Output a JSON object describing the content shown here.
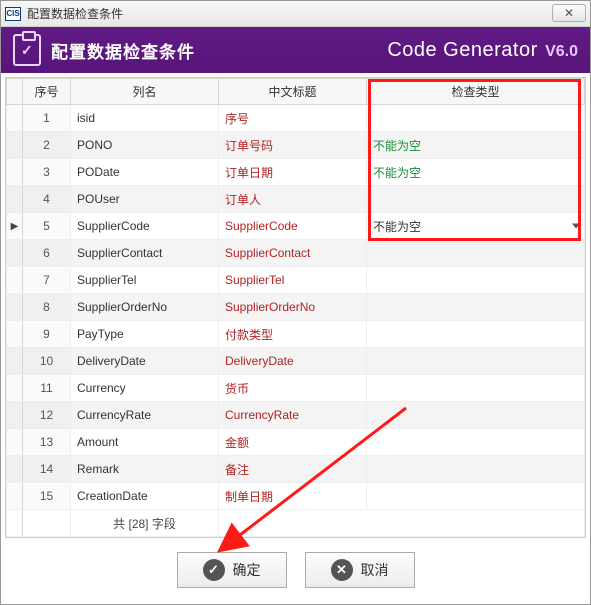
{
  "window": {
    "app_icon_text": "CIS",
    "title": "配置数据检查条件"
  },
  "banner": {
    "title": "配置数据检查条件",
    "brand": "Code Generator",
    "version": "V6.0"
  },
  "grid": {
    "headers": {
      "index": "序号",
      "col_name": "列名",
      "cn_title": "中文标题",
      "check_type": "检查类型"
    },
    "rows": [
      {
        "idx": "1",
        "name": "isid",
        "cn": "序号",
        "check": "",
        "marker": false,
        "dropdown": false
      },
      {
        "idx": "2",
        "name": "PONO",
        "cn": "订单号码",
        "check": "不能为空",
        "marker": false,
        "dropdown": false
      },
      {
        "idx": "3",
        "name": "PODate",
        "cn": "订单日期",
        "check": "不能为空",
        "marker": false,
        "dropdown": false
      },
      {
        "idx": "4",
        "name": "POUser",
        "cn": "订单人",
        "check": "",
        "marker": false,
        "dropdown": false
      },
      {
        "idx": "5",
        "name": "SupplierCode",
        "cn": "SupplierCode",
        "check": "不能为空",
        "marker": true,
        "dropdown": true
      },
      {
        "idx": "6",
        "name": "SupplierContact",
        "cn": "SupplierContact",
        "check": "",
        "marker": false,
        "dropdown": false
      },
      {
        "idx": "7",
        "name": "SupplierTel",
        "cn": "SupplierTel",
        "check": "",
        "marker": false,
        "dropdown": false
      },
      {
        "idx": "8",
        "name": "SupplierOrderNo",
        "cn": "SupplierOrderNo",
        "check": "",
        "marker": false,
        "dropdown": false
      },
      {
        "idx": "9",
        "name": "PayType",
        "cn": "付款类型",
        "check": "",
        "marker": false,
        "dropdown": false
      },
      {
        "idx": "10",
        "name": "DeliveryDate",
        "cn": "DeliveryDate",
        "check": "",
        "marker": false,
        "dropdown": false
      },
      {
        "idx": "11",
        "name": "Currency",
        "cn": "货币",
        "check": "",
        "marker": false,
        "dropdown": false
      },
      {
        "idx": "12",
        "name": "CurrencyRate",
        "cn": "CurrencyRate",
        "check": "",
        "marker": false,
        "dropdown": false
      },
      {
        "idx": "13",
        "name": "Amount",
        "cn": "金额",
        "check": "",
        "marker": false,
        "dropdown": false
      },
      {
        "idx": "14",
        "name": "Remark",
        "cn": "备注",
        "check": "",
        "marker": false,
        "dropdown": false
      },
      {
        "idx": "15",
        "name": "CreationDate",
        "cn": "制单日期",
        "check": "",
        "marker": false,
        "dropdown": false
      }
    ],
    "footer": "共 [28] 字段"
  },
  "buttons": {
    "ok": "确定",
    "cancel": "取消"
  }
}
